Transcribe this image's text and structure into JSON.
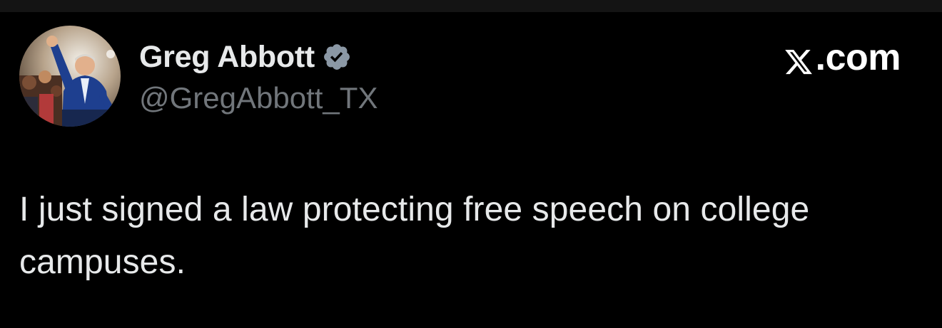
{
  "post": {
    "author": {
      "display_name": "Greg Abbott",
      "handle": "@GregAbbott_TX",
      "verified_icon": "verified-badge-icon",
      "verified_color": "#8b98a5"
    },
    "brand": {
      "suffix": ".com",
      "logo_icon": "x-logo-icon"
    },
    "text": "I just signed a law protecting free speech on college campuses."
  },
  "colors": {
    "background": "#000000",
    "name": "#e7e9ea",
    "handle": "#71767b",
    "body_text": "#e7e9ea",
    "brand": "#ffffff"
  }
}
